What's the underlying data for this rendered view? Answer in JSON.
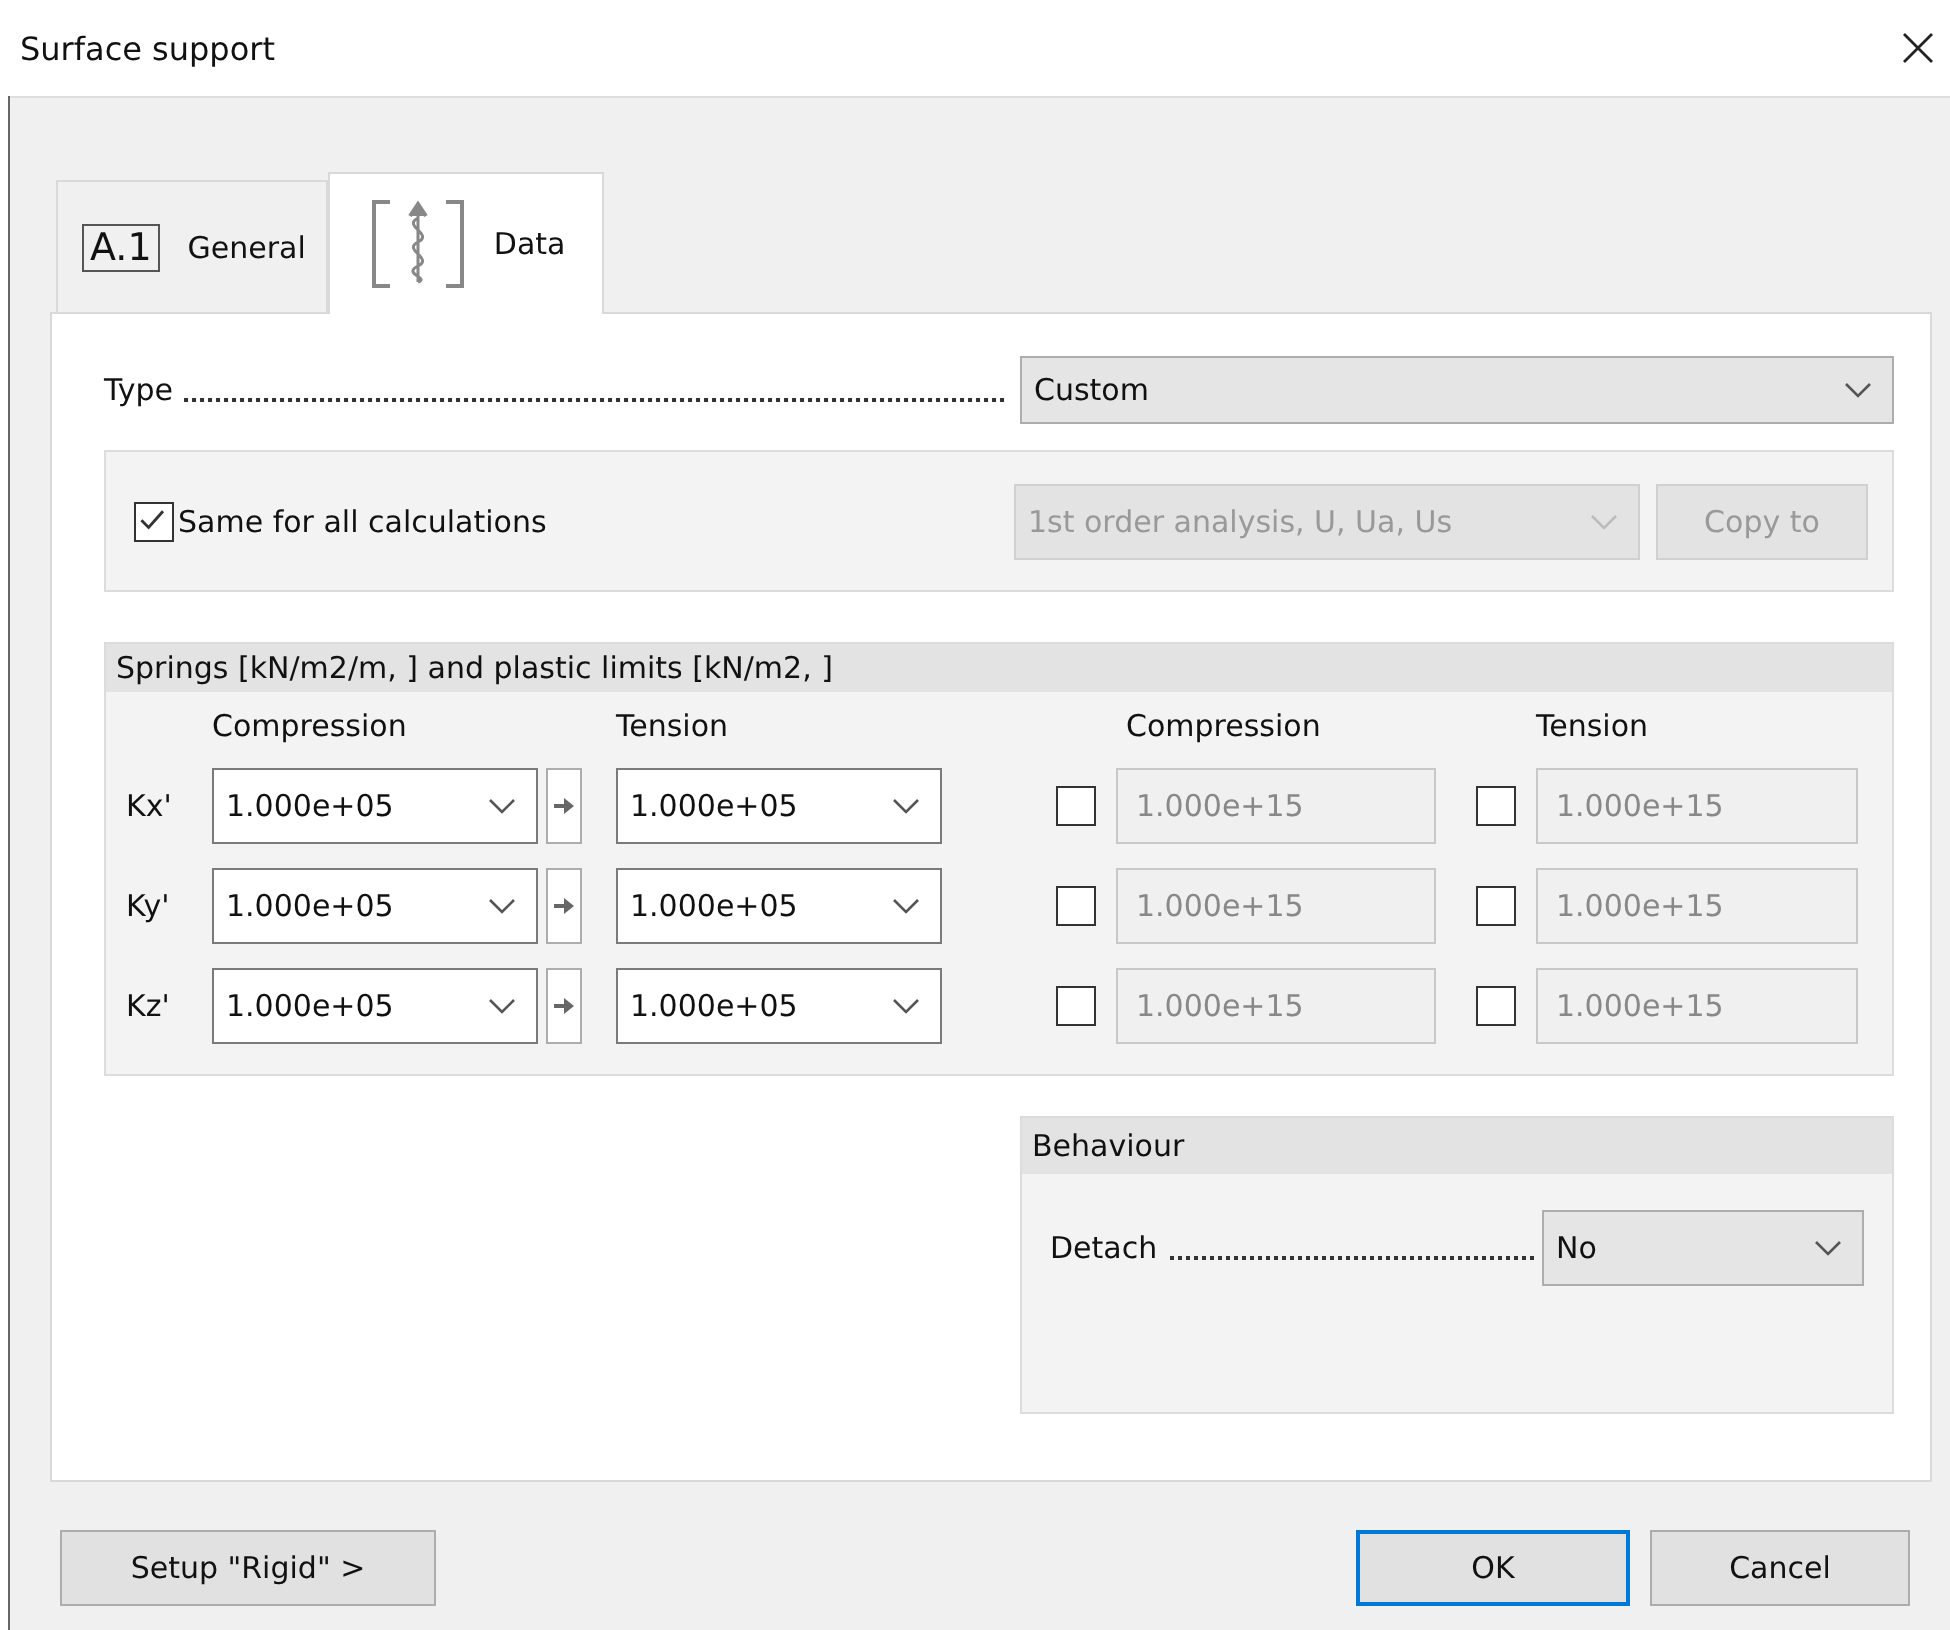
{
  "window": {
    "title": "Surface support"
  },
  "tabs": [
    {
      "label": "General",
      "icon_text": "A.1",
      "kind": "text",
      "selected": false
    },
    {
      "label": "Data",
      "kind": "spring",
      "selected": true
    }
  ],
  "type_field": {
    "label": "Type",
    "value": "Custom"
  },
  "calculations": {
    "same_for_all": {
      "label": "Same for all calculations",
      "checked": true
    },
    "combo": {
      "value": "1st order analysis, U, Ua, Us",
      "disabled": true
    },
    "copy_button": {
      "label": "Copy to",
      "disabled": true
    }
  },
  "springs": {
    "title": "Springs [kN/m2/m, ] and plastic limits [kN/m2, ]",
    "headers": [
      "Compression",
      "Tension",
      "Compression",
      "Tension"
    ],
    "rows": [
      {
        "label": "Kx'",
        "compression": "1.000e+05",
        "tension": "1.000e+05",
        "limits": [
          {
            "checked": false,
            "value": "1.000e+15"
          },
          {
            "checked": false,
            "value": "1.000e+15"
          }
        ]
      },
      {
        "label": "Ky'",
        "compression": "1.000e+05",
        "tension": "1.000e+05",
        "limits": [
          {
            "checked": false,
            "value": "1.000e+15"
          },
          {
            "checked": false,
            "value": "1.000e+15"
          }
        ]
      },
      {
        "label": "Kz'",
        "compression": "1.000e+05",
        "tension": "1.000e+05",
        "limits": [
          {
            "checked": false,
            "value": "1.000e+15"
          },
          {
            "checked": false,
            "value": "1.000e+15"
          }
        ]
      }
    ]
  },
  "behaviour": {
    "title": "Behaviour",
    "detach": {
      "label": "Detach",
      "value": "No"
    }
  },
  "buttons": {
    "setup": "Setup \"Rigid\" >",
    "ok": "OK",
    "cancel": "Cancel"
  }
}
